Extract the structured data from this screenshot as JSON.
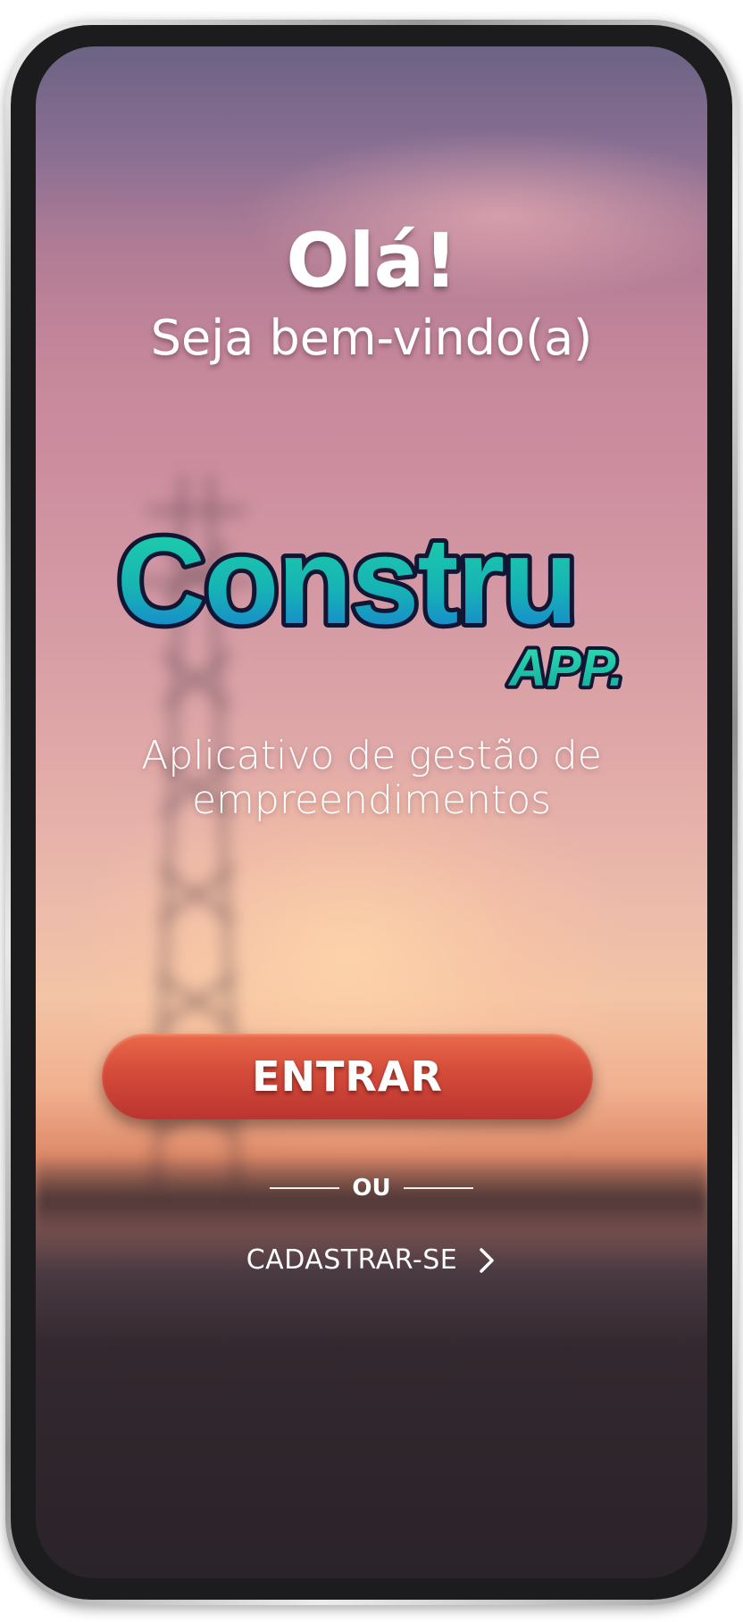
{
  "welcome": {
    "greeting": "Olá!",
    "subtitle": "Seja bem-vindo(a)"
  },
  "logo": {
    "name": "Constru",
    "suffix": "APP."
  },
  "tagline": {
    "line1": "Aplicativo de gestão de",
    "line2": "empreendimentos"
  },
  "actions": {
    "enter_label": "ENTRAR",
    "divider_label": "OU",
    "signup_label": "CADASTRAR-SE",
    "signup_icon": "chevron-right-icon"
  },
  "colors": {
    "button_primary": "#d44b3a",
    "logo_gradient_start": "#1fd4a6",
    "logo_gradient_end": "#1976d8",
    "logo_outline": "#101633"
  }
}
